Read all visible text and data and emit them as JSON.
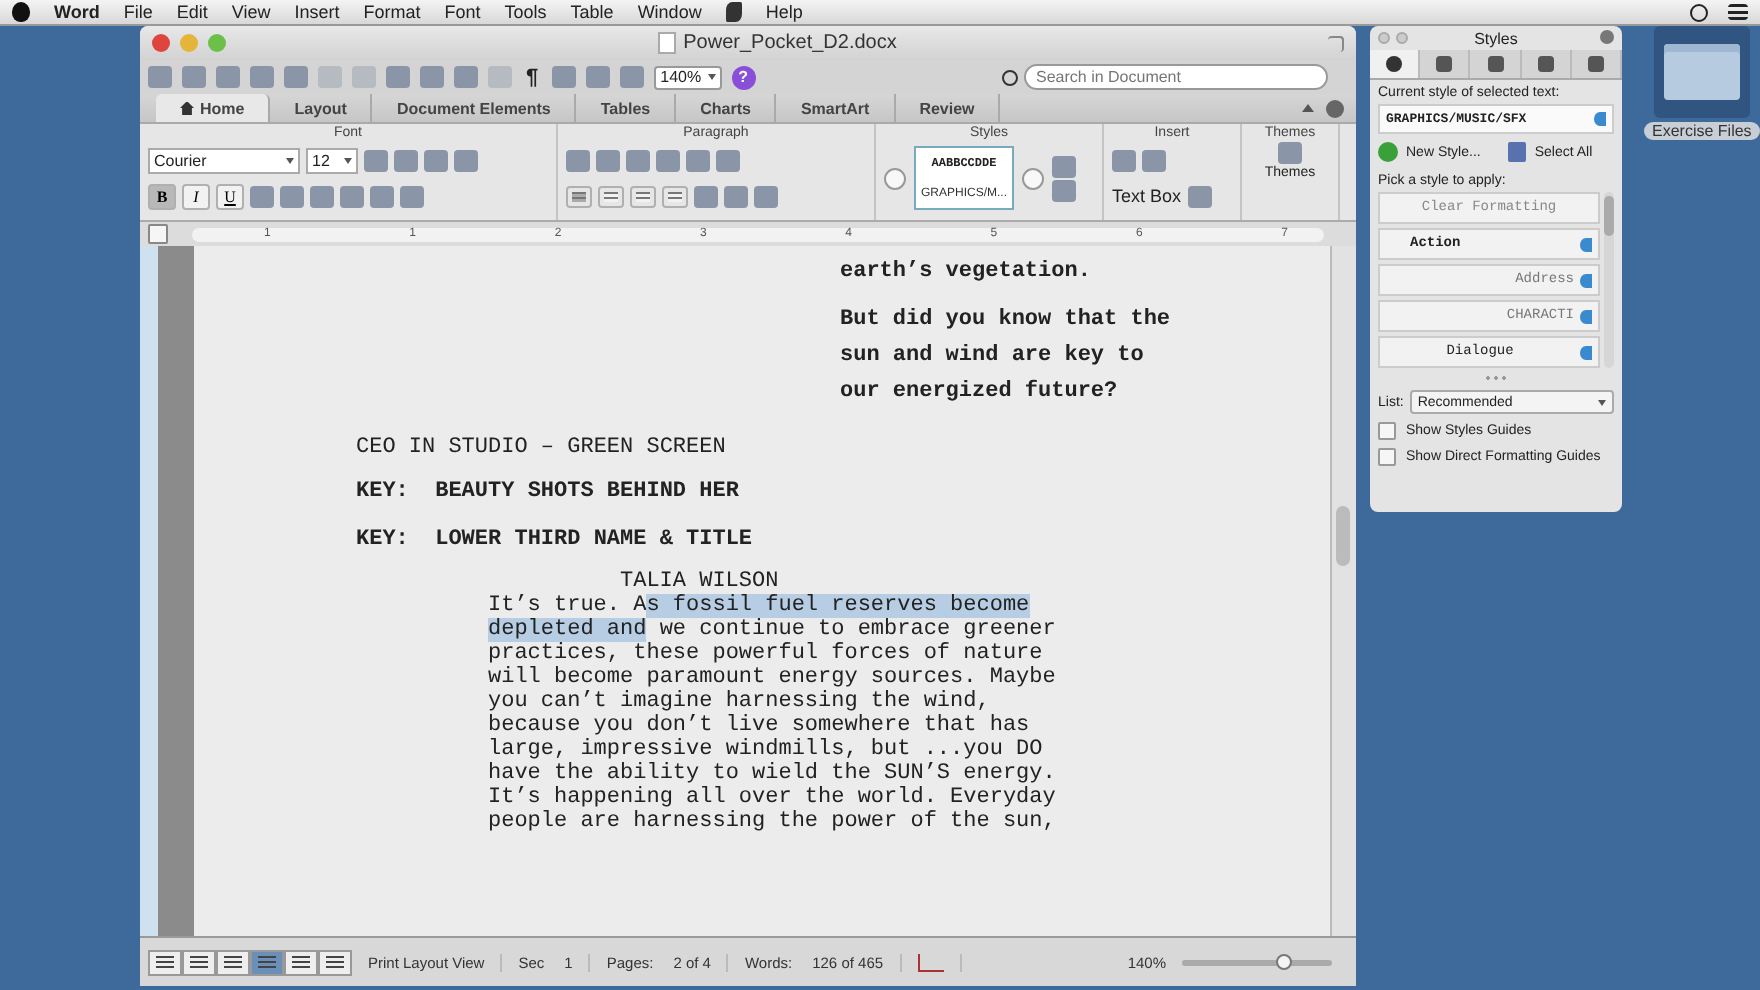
{
  "menu_bar": {
    "app": "Word",
    "items": [
      "File",
      "Edit",
      "View",
      "Insert",
      "Format",
      "Font",
      "Tools",
      "Table",
      "Window"
    ],
    "help": "Help"
  },
  "window": {
    "title": "Power_Pocket_D2.docx"
  },
  "toolbar": {
    "show_marks": "¶",
    "zoom": "140%",
    "help": "?",
    "search": {
      "placeholder": "Search in Document"
    }
  },
  "tabs": [
    {
      "label": "Home",
      "selected": true
    },
    {
      "label": "Layout",
      "selected": false
    },
    {
      "label": "Document Elements",
      "selected": false
    },
    {
      "label": "Tables",
      "selected": false
    },
    {
      "label": "Charts",
      "selected": false
    },
    {
      "label": "SmartArt",
      "selected": false
    },
    {
      "label": "Review",
      "selected": false
    }
  ],
  "ribbon": {
    "font_group": {
      "label": "Font",
      "font": "Courier",
      "size": "12",
      "format_buttons": [
        {
          "label": "B",
          "kind": "bold",
          "selected": true
        },
        {
          "label": "I",
          "kind": "italic",
          "selected": false
        },
        {
          "label": "U",
          "kind": "underline",
          "selected": false
        }
      ]
    },
    "paragraph_group": {
      "label": "Paragraph",
      "alignments": [
        {
          "selected": true
        },
        {
          "selected": false
        },
        {
          "selected": false
        },
        {
          "selected": false
        }
      ]
    },
    "styles_group": {
      "label": "Styles",
      "sample": "AABBCCDDE",
      "style_name": "GRAPHICS/M..."
    },
    "insert_group": {
      "label": "Insert",
      "text_box": "Text Box"
    },
    "themes_group": {
      "label": "Themes",
      "button": "Themes"
    }
  },
  "ruler": {
    "marks": [
      "1",
      "1",
      "2",
      "3",
      "4",
      "5",
      "6",
      "7"
    ]
  },
  "document": {
    "blocks": [
      {
        "kind": "aside",
        "text": "earth’s vegetation."
      },
      {
        "kind": "aside",
        "text": "But did you know that the sun and wind are key to our energized future?"
      },
      {
        "kind": "scene",
        "text": "CEO IN STUDIO – GREEN SCREEN"
      },
      {
        "kind": "key",
        "text": "KEY:  BEAUTY SHOTS BEHIND HER"
      },
      {
        "kind": "key",
        "text": "KEY:  LOWER THIRD NAME & TITLE"
      },
      {
        "kind": "character",
        "text": "TALIA WILSON"
      },
      {
        "kind": "dialogue",
        "before": "It’s true. A",
        "selection": "s fossil fuel reserves become depleted and",
        "after": " we continue to embrace greener practices, these powerful forces of nature will become paramount energy sources. Maybe you can’t imagine harnessing the wind, because you don’t live somewhere that has large, impressive windmills, but ...you DO have the ability to wield the SUN’S energy. It’s happening all over the world. Everyday people are harnessing the power of the sun,"
      }
    ]
  },
  "status_bar": {
    "views": [
      {
        "selected": false
      },
      {
        "selected": false
      },
      {
        "selected": false
      },
      {
        "selected": true
      },
      {
        "selected": false
      },
      {
        "selected": false
      }
    ],
    "view_name": "Print Layout View",
    "section_label": "Sec",
    "section": "1",
    "pages_label": "Pages:",
    "pages": "2 of 4",
    "words_label": "Words:",
    "words": "126 of 465",
    "zoom": "140%",
    "zoom_slider": {
      "level": 0.68
    }
  },
  "styles_panel": {
    "title": "Styles",
    "tabs": [
      {
        "selected": true
      },
      {
        "selected": false
      },
      {
        "selected": false
      },
      {
        "selected": false
      },
      {
        "selected": false
      }
    ],
    "current_label": "Current style of selected text:",
    "current_style": "GRAPHICS/MUSIC/SFX",
    "new_style": "New Style...",
    "select_all": "Select All",
    "pick_label": "Pick a style to apply:",
    "styles": [
      {
        "name": "Clear Formatting",
        "kind": "clear"
      },
      {
        "name": "Action",
        "kind": "left"
      },
      {
        "name": "Address",
        "kind": "right"
      },
      {
        "name": "CHARACTI",
        "kind": "right"
      },
      {
        "name": "Dialogue",
        "kind": "center"
      }
    ],
    "list_label": "List:",
    "list_value": "Recommended",
    "options": [
      {
        "label": "Show Styles Guides",
        "checked": false
      },
      {
        "label": "Show Direct Formatting Guides",
        "checked": false
      }
    ]
  },
  "desktop": {
    "folder": "Exercise Files"
  }
}
